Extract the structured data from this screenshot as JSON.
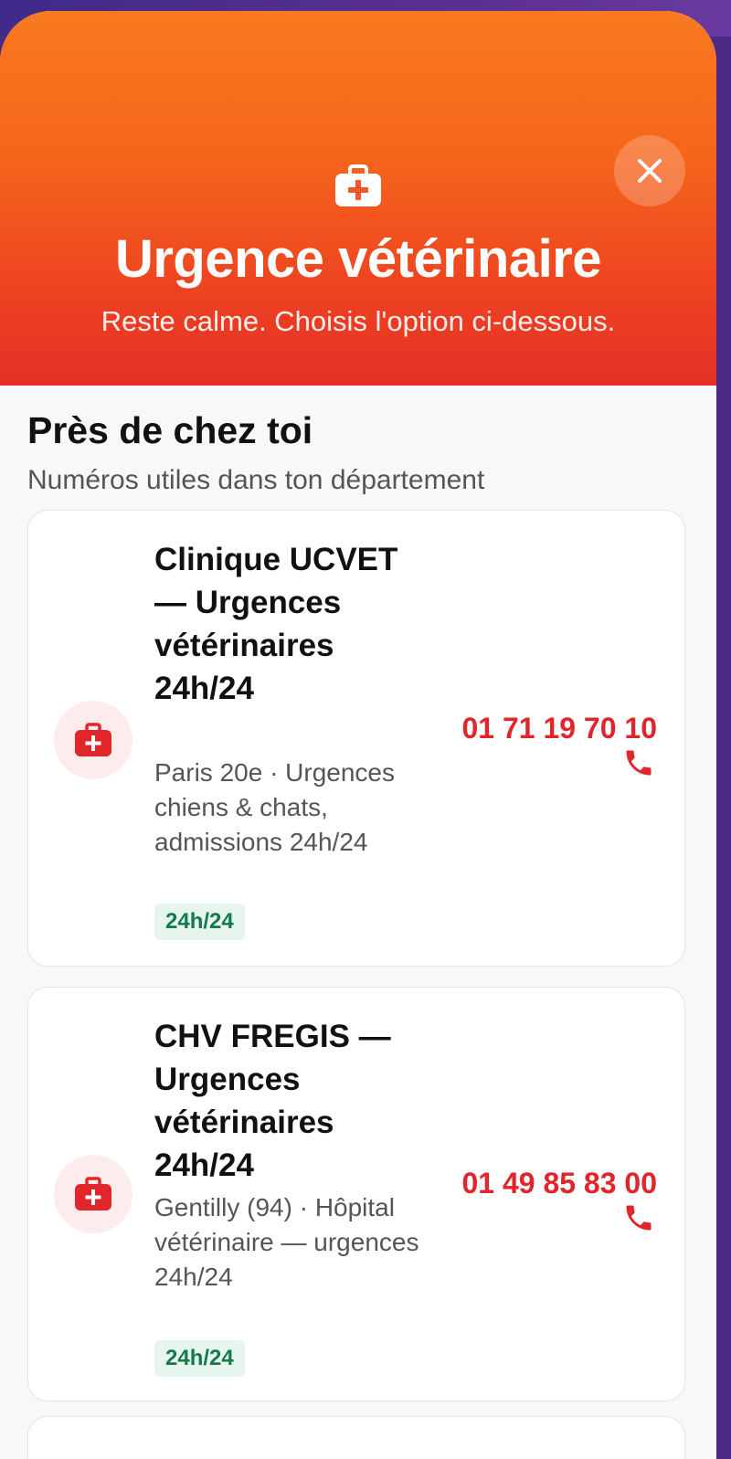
{
  "header": {
    "title": "Urgence vétérinaire",
    "subtitle": "Reste calme. Choisis l'option ci-dessous.",
    "icon": "medical-kit-icon",
    "close_icon": "close-icon"
  },
  "section": {
    "title": "Près de chez toi",
    "subtitle": "Numéros utiles dans ton département"
  },
  "clinics": [
    {
      "name": "Clinique UCVET — Urgences vétérinaires 24h/24",
      "description": "Paris 20e · Urgences chiens & chats, admissions 24h/24",
      "badge": "24h/24",
      "phone": "01 71 19 70 10"
    },
    {
      "name": "CHV FREGIS — Urgences vétérinaires 24h/24",
      "description": "Gentilly (94) · Hôpital vétérinaire — urgences 24h/24",
      "badge": "24h/24",
      "phone": "01 49 85 83 00"
    }
  ],
  "colors": {
    "header_top": "#f97a1e",
    "header_bottom": "#e63027",
    "accent_red": "#e0262b",
    "badge_green": "#137a4a",
    "badge_bg": "#e6f6ee"
  }
}
